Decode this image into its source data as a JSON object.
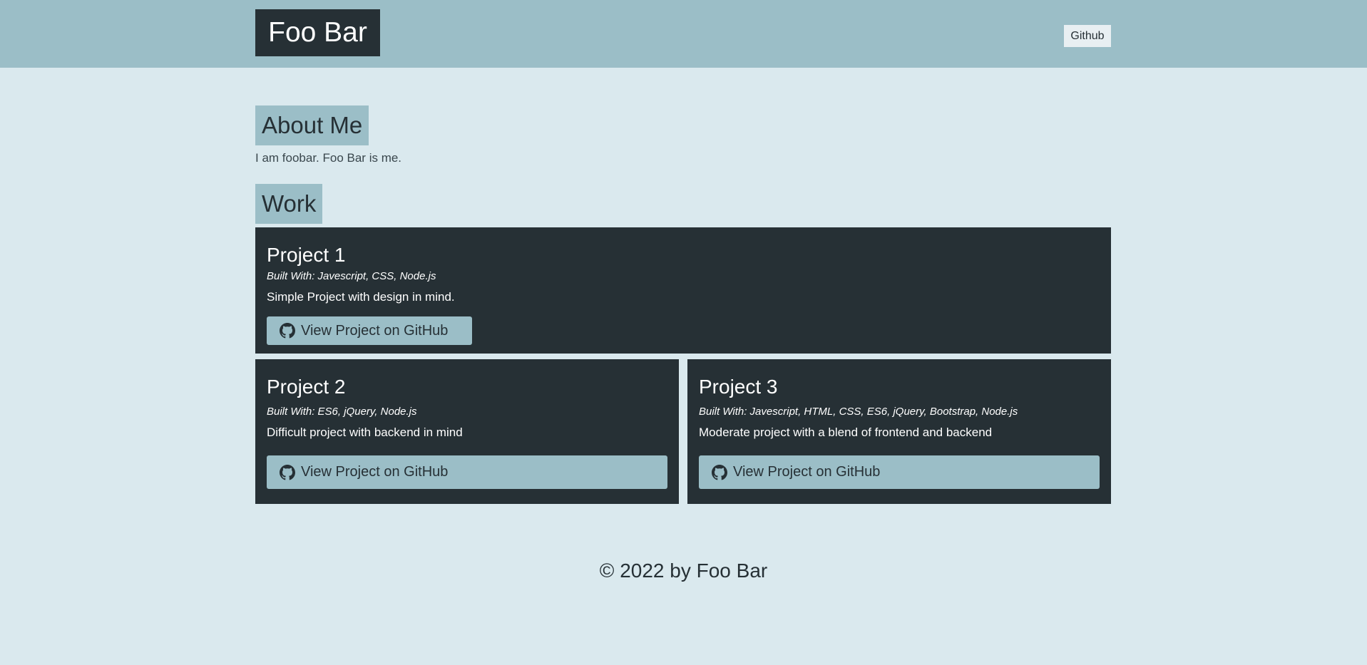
{
  "header": {
    "brand": "Foo Bar",
    "nav_link": "Github"
  },
  "about": {
    "title": "About Me",
    "text": "I am foobar. Foo Bar is me."
  },
  "work": {
    "title": "Work",
    "projects": [
      {
        "title": "Project 1",
        "built_with": "Built With: Javescript, CSS, Node.js",
        "description": "Simple Project with design in mind.",
        "button_label": "View Project on GitHub",
        "button_icon": "github-icon"
      },
      {
        "title": "Project 2",
        "built_with": "Built With: ES6, jQuery, Node.js",
        "description": "Difficult project with backend in mind",
        "button_label": "View Project on GitHub",
        "button_icon": "github-icon"
      },
      {
        "title": "Project 3",
        "built_with": "Built With: Javescript, HTML, CSS, ES6, jQuery, Bootstrap, Node.js",
        "description": "Moderate project with a blend of frontend and backend",
        "button_label": "View Project on GitHub",
        "button_icon": "github-icon"
      }
    ]
  },
  "footer": {
    "text": "© 2022 by Foo Bar"
  },
  "colors": {
    "page_bg": "#dae9ee",
    "header_bg": "#9bbec7",
    "card_bg": "#263035",
    "accent": "#9bbec7",
    "text_dark": "#263035"
  }
}
